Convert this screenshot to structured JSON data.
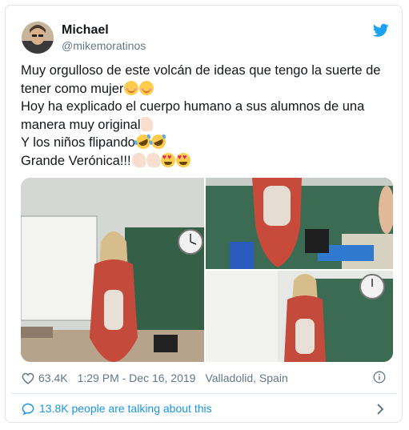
{
  "author": {
    "name": "Michael",
    "handle": "@mikemoratinos"
  },
  "tweet": {
    "lines": [
      "Muy orgulloso de este volcán de ideas que tengo la suerte de",
      "tener como mujer",
      "Hoy ha explicado el cuerpo humano a sus alumnos de una",
      "manera muy original",
      "Y los niños flipando",
      "Grande Verónica!!!"
    ],
    "emoji": {
      "line2": [
        "smiling-face-icon",
        "smiling-face-icon"
      ],
      "line4": [
        "thumbs-up-icon"
      ],
      "line5": [
        "rolling-on-floor-laughing-icon",
        "rolling-on-floor-laughing-icon"
      ],
      "line6": [
        "clapping-hands-icon",
        "clapping-hands-icon",
        "heart-eyes-icon",
        "heart-eyes-icon"
      ]
    }
  },
  "meta": {
    "likes": "63.4K",
    "timestamp": "1:29 PM - Dec 16, 2019",
    "location": "Valladolid, Spain"
  },
  "footer": {
    "talking": "13.8K people are talking about this"
  },
  "colors": {
    "link": "#1b95e0",
    "muted": "#657786",
    "text": "#14171a",
    "twitter_blue": "#1da1f2"
  }
}
